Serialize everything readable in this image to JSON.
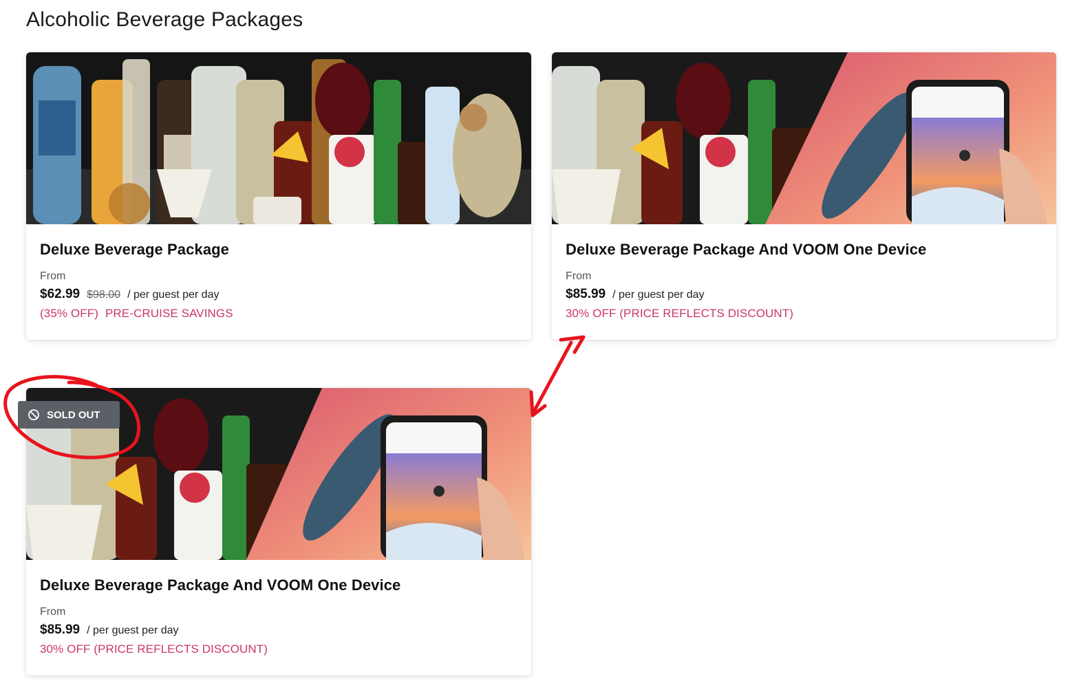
{
  "page": {
    "title": "Alcoholic Beverage Packages"
  },
  "cards": [
    {
      "title": "Deluxe Beverage Package",
      "from_label": "From",
      "price": "$62.99",
      "old_price": "$98.00",
      "per_label": "/ per guest per day",
      "discount_percent": "(35% OFF)",
      "discount_note": "PRE-CRUISE SAVINGS",
      "image_icon": "beverage-bottles-image"
    },
    {
      "title": "Deluxe Beverage Package And VOOM One Device",
      "from_label": "From",
      "price": "$85.99",
      "per_label": "/ per guest per day",
      "discount_note": "30% OFF (PRICE REFLECTS DISCOUNT)",
      "image_icon": "beverage-and-phone-image"
    },
    {
      "title": "Deluxe Beverage Package And VOOM One Device",
      "from_label": "From",
      "price": "$85.99",
      "per_label": "/ per guest per day",
      "discount_note": "30% OFF (PRICE REFLECTS DISCOUNT)",
      "badge": "SOLD OUT",
      "badge_icon": "ban-icon",
      "image_icon": "beverage-and-phone-image"
    }
  ],
  "colors": {
    "accent": "#c9356b",
    "badge_bg": "#5b6066",
    "annotation": "#e8141c"
  }
}
